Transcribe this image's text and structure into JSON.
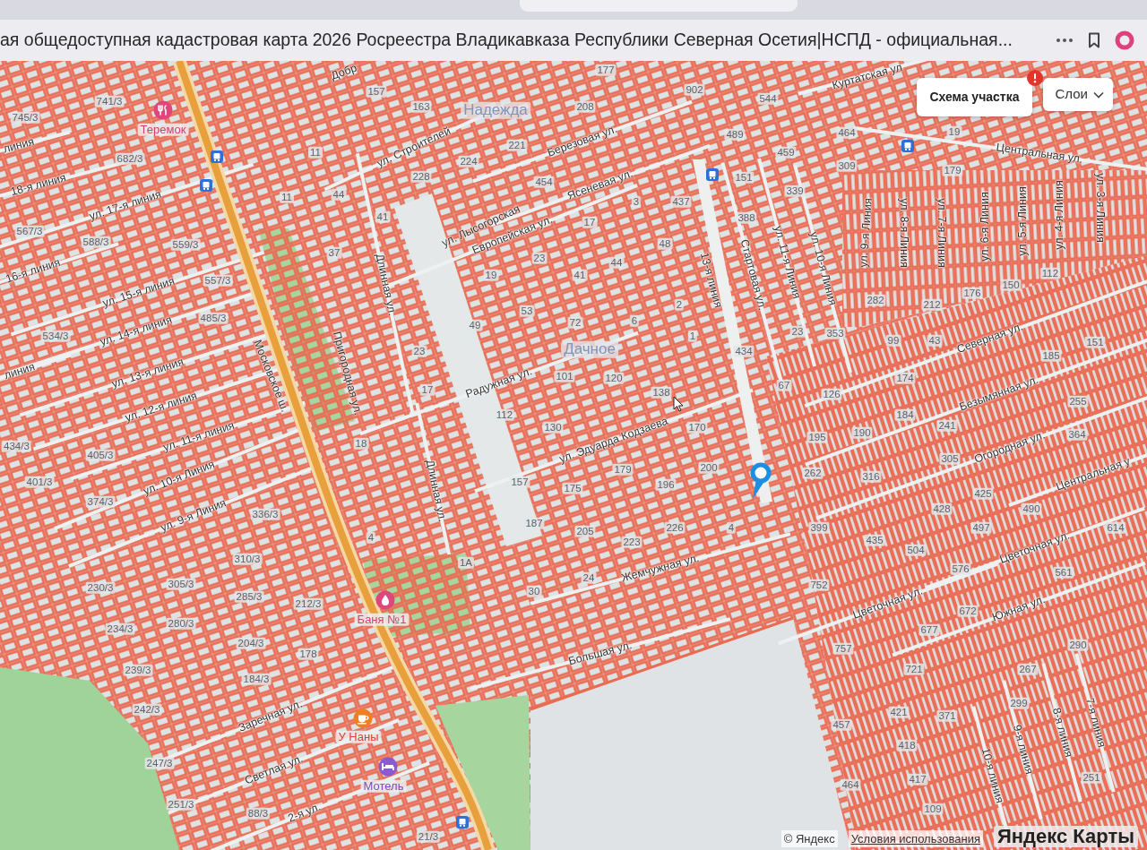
{
  "browser": {
    "title": "ая общедоступная кадастровая карта 2026 Росреестра Владикавказа Республики Северная Осетия|НСПД - официальная..."
  },
  "map": {
    "controls": [
      {
        "kind": "button",
        "label": "Схема участка",
        "alert": true
      },
      {
        "kind": "dropdown",
        "label": "Слои"
      }
    ],
    "districts": [
      "Надежда",
      "Дачное"
    ],
    "streets": [
      "Добр",
      "Куртатская ул",
      "линия",
      "18-я линия",
      "ул. 17-я линия",
      "16-я линия",
      "ул. 15-я линия",
      "ул. 14-я линия",
      "линия",
      "ул. 13-я линия",
      "ул. 12-я линия",
      "ул. 11-я линия",
      "ул. 10-я Линия",
      "ул. 9-я Линия",
      "Московское ш.",
      "Пригородная ул.",
      "Длинная ул.",
      "ул. Строителей",
      "Березовая ул.",
      "Ясеневая ул.",
      "ул. Лысогорская",
      "Европейская ул.",
      "Радужная ул.",
      "ул. Эдуарда Кодзаева",
      "Длинная ул.",
      "13-я линия",
      "Стартовая ул.",
      "ул. 11-я Линия",
      "ул. 10-я Линия",
      "ул. 9-я Линия",
      "ул. 8-я Линия",
      "ул. 7-я Линия",
      "ул. 6-я Линия",
      "ул. 5-я Линия",
      "ул. 4-я Линия",
      "ул. 3-я Линия",
      "Центральная ул.",
      "Северная ул.",
      "Безымянная ул.",
      "Огородная ул.",
      "Центральная у",
      "Жемчужная ул.",
      "Большая ул.",
      "Цветочная ул.",
      "Цветочная ул.",
      "Южная ул.",
      "Заречная ул.",
      "Светлая ул.",
      "2-я ул.",
      "10-я линия",
      "9-я линия",
      "8-я линия",
      "7-я линия"
    ],
    "pois": [
      {
        "kind": "restaurant",
        "name": "Теремок"
      },
      {
        "kind": "bathhouse",
        "name": "Баня №1"
      },
      {
        "kind": "cafe",
        "name": "У Наны"
      },
      {
        "kind": "hotel",
        "name": "Мотель"
      }
    ],
    "parcels": [
      "177",
      "157",
      "902",
      "741/3",
      "544",
      "163",
      "208",
      "745/3",
      "489",
      "464",
      "19",
      "221",
      "11",
      "459",
      "682/3",
      "224",
      "309",
      "179",
      "228",
      "454",
      "151",
      "44",
      "339",
      "11",
      "3",
      "437",
      "41",
      "17",
      "388",
      "567/3",
      "588/3",
      "559/3",
      "48",
      "37",
      "23",
      "44",
      "19",
      "41",
      "112",
      "557/3",
      "150",
      "176",
      "2",
      "282",
      "212",
      "485/3",
      "49",
      "53",
      "72",
      "6",
      "534/3",
      "1",
      "23",
      "353",
      "99",
      "43",
      "151",
      "23",
      "434",
      "185",
      "101",
      "120",
      "174",
      "17",
      "138",
      "67",
      "126",
      "255",
      "112",
      "184",
      "130",
      "170",
      "241",
      "195",
      "190",
      "364",
      "434/3",
      "18",
      "405/3",
      "305",
      "179",
      "200",
      "262",
      "401/3",
      "157",
      "316",
      "175",
      "196",
      "425",
      "374/3",
      "336/3",
      "428",
      "490",
      "187",
      "226",
      "4",
      "399",
      "497",
      "614",
      "4",
      "205",
      "223",
      "435",
      "504",
      "310/3",
      "1А",
      "576",
      "561",
      "230/3",
      "305/3",
      "30",
      "24",
      "752",
      "285/3",
      "212/3",
      "672",
      "234/3",
      "280/3",
      "677",
      "204/3",
      "757",
      "290",
      "178",
      "239/3",
      "721",
      "267",
      "184/3",
      "242/3",
      "299",
      "421",
      "371",
      "457",
      "418",
      "247/3",
      "464",
      "417",
      "251",
      "251/3",
      "88/3",
      "109",
      "21/3"
    ],
    "attribution": {
      "copyright": "© Яндекс",
      "terms_link": "Условия использования",
      "logo": "Яндекс Карты"
    }
  }
}
